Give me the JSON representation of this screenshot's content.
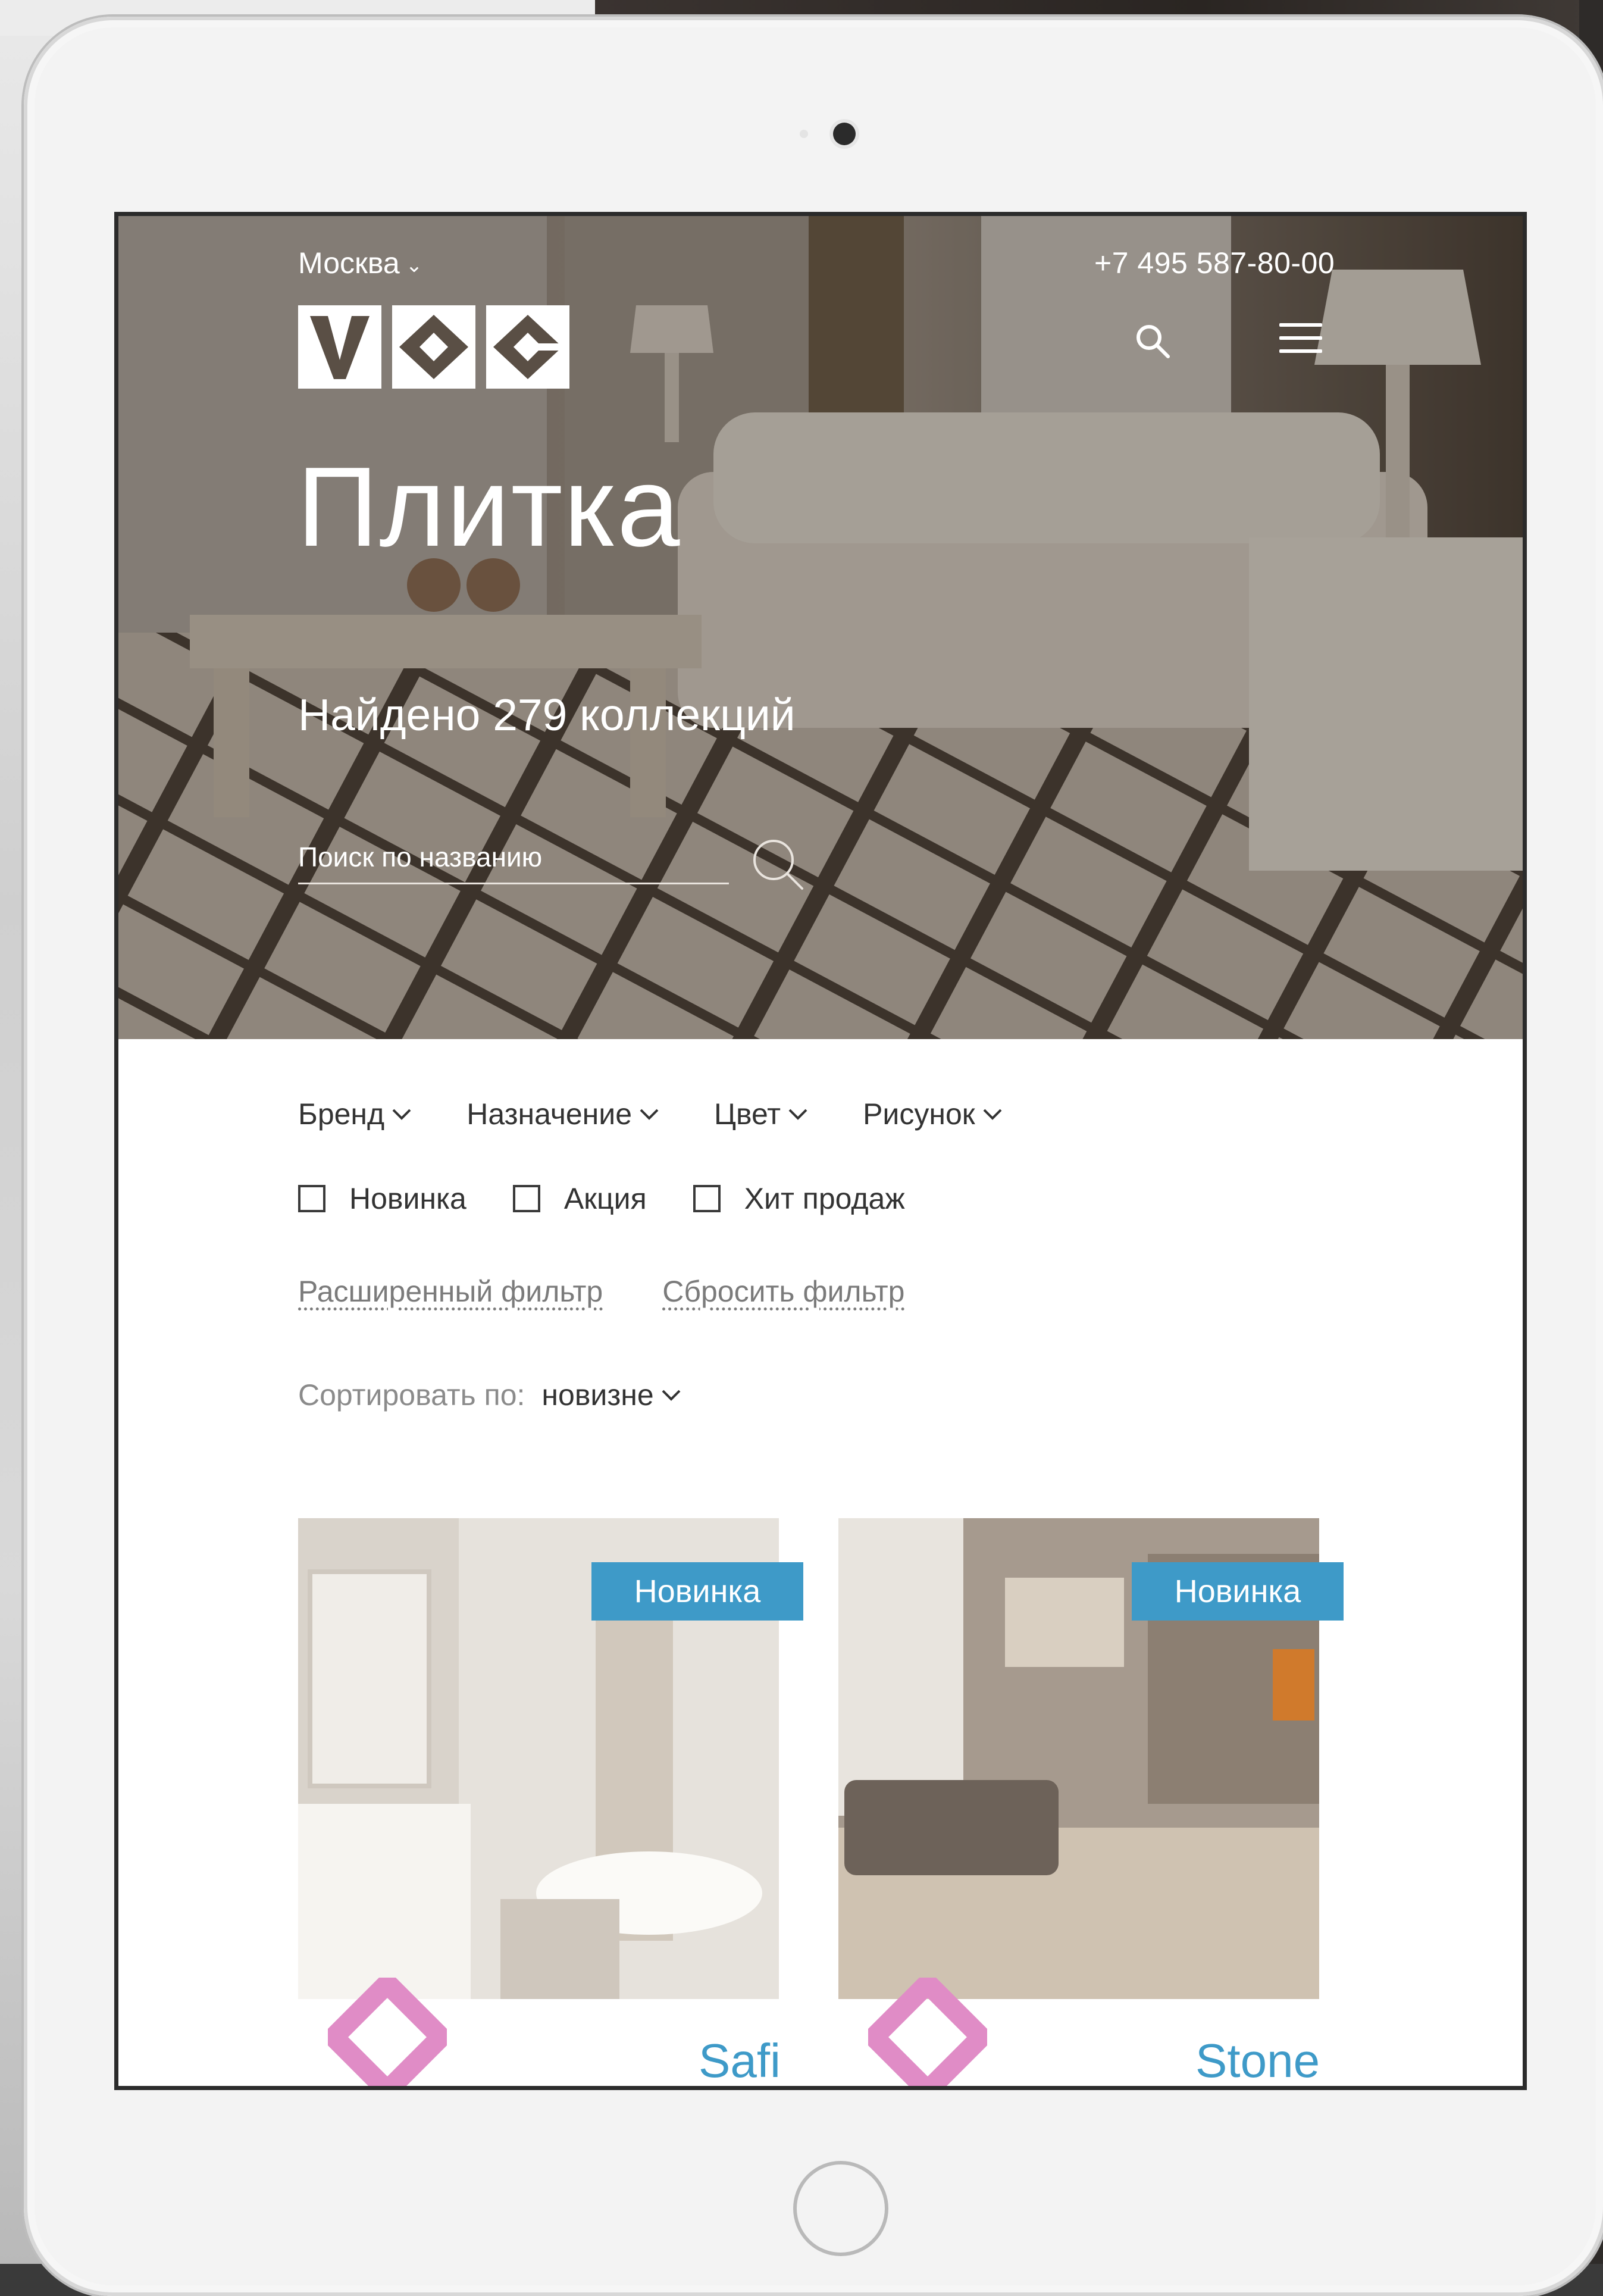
{
  "header": {
    "city": "Москва",
    "phone": "+7 495 587-80-00",
    "logo_text": "VOG"
  },
  "hero": {
    "title": "Плитка",
    "found": "Найдено 279 коллекций",
    "search_placeholder": "Поиск по названию"
  },
  "filters": [
    {
      "label": "Бренд"
    },
    {
      "label": "Назначение"
    },
    {
      "label": "Цвет"
    },
    {
      "label": "Рисунок"
    }
  ],
  "checkboxes": [
    {
      "label": "Новинка",
      "checked": false
    },
    {
      "label": "Акция",
      "checked": false
    },
    {
      "label": "Хит продаж",
      "checked": false
    }
  ],
  "links": {
    "advanced": "Расширенный фильтр",
    "reset": "Сбросить фильтр"
  },
  "sort": {
    "label": "Сортировать по:",
    "value": "новизне"
  },
  "products": [
    {
      "name": "Safi",
      "badge": "Новинка"
    },
    {
      "name": "Stone",
      "badge": "Новинка"
    }
  ],
  "colors": {
    "accent": "#3e9ac8",
    "diamond": "#e08cc6"
  }
}
